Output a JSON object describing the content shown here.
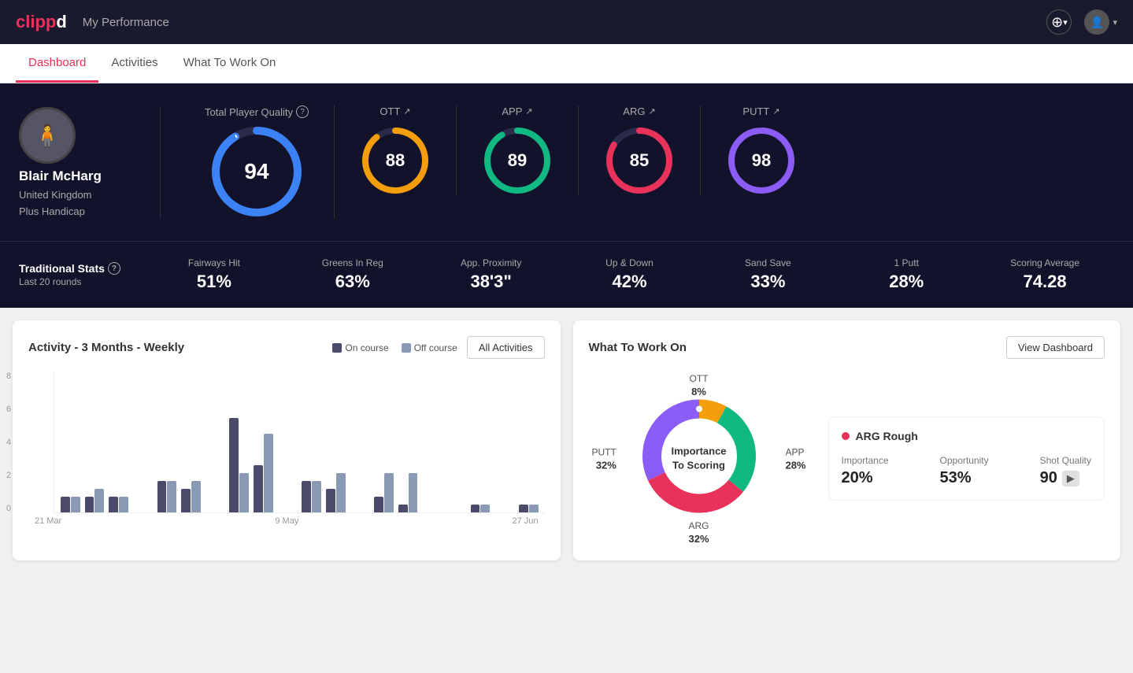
{
  "header": {
    "logo": "clippd",
    "title": "My Performance",
    "add_icon": "+",
    "chevron_down": "▾"
  },
  "tabs": [
    {
      "id": "dashboard",
      "label": "Dashboard",
      "active": true
    },
    {
      "id": "activities",
      "label": "Activities",
      "active": false
    },
    {
      "id": "what-to-work-on",
      "label": "What To Work On",
      "active": false
    }
  ],
  "player": {
    "name": "Blair McHarg",
    "country": "United Kingdom",
    "handicap": "Plus Handicap"
  },
  "scores": {
    "total": {
      "label": "Total Player Quality",
      "value": "94",
      "color": "#3b82f6"
    },
    "ott": {
      "label": "OTT",
      "value": "88",
      "color": "#f59e0b"
    },
    "app": {
      "label": "APP",
      "value": "89",
      "color": "#10b981"
    },
    "arg": {
      "label": "ARG",
      "value": "85",
      "color": "#e8325a"
    },
    "putt": {
      "label": "PUTT",
      "value": "98",
      "color": "#8b5cf6"
    }
  },
  "traditional_stats": {
    "title": "Traditional Stats",
    "subtitle": "Last 20 rounds",
    "stats": [
      {
        "label": "Fairways Hit",
        "value": "51%"
      },
      {
        "label": "Greens In Reg",
        "value": "63%"
      },
      {
        "label": "App. Proximity",
        "value": "38'3\""
      },
      {
        "label": "Up & Down",
        "value": "42%"
      },
      {
        "label": "Sand Save",
        "value": "33%"
      },
      {
        "label": "1 Putt",
        "value": "28%"
      },
      {
        "label": "Scoring Average",
        "value": "74.28"
      }
    ]
  },
  "activity_chart": {
    "title": "Activity - 3 Months - Weekly",
    "legend": {
      "on_course": "On course",
      "off_course": "Off course"
    },
    "all_activities_btn": "All Activities",
    "y_axis": [
      "8",
      "6",
      "4",
      "2",
      "0"
    ],
    "x_axis": [
      "21 Mar",
      "9 May",
      "27 Jun"
    ],
    "bars": [
      {
        "on": 1,
        "off": 1
      },
      {
        "on": 1,
        "off": 1.5
      },
      {
        "on": 1,
        "off": 1
      },
      {
        "on": 0,
        "off": 0
      },
      {
        "on": 2,
        "off": 2
      },
      {
        "on": 1.5,
        "off": 2
      },
      {
        "on": 0,
        "off": 0
      },
      {
        "on": 6,
        "off": 2.5
      },
      {
        "on": 3,
        "off": 5
      },
      {
        "on": 0,
        "off": 0
      },
      {
        "on": 2,
        "off": 2
      },
      {
        "on": 1.5,
        "off": 2.5
      },
      {
        "on": 0,
        "off": 0
      },
      {
        "on": 1,
        "off": 2.5
      },
      {
        "on": 0.5,
        "off": 2.5
      },
      {
        "on": 0,
        "off": 0
      },
      {
        "on": 0,
        "off": 0
      },
      {
        "on": 0.5,
        "off": 0.5
      },
      {
        "on": 0,
        "off": 0
      },
      {
        "on": 0.5,
        "off": 0.5
      }
    ],
    "max_value": 9
  },
  "what_to_work_on": {
    "title": "What To Work On",
    "view_dashboard_btn": "View Dashboard",
    "donut_center": "Importance\nTo Scoring",
    "segments": [
      {
        "label": "OTT",
        "pct": "8%",
        "color": "#f59e0b",
        "position": "top"
      },
      {
        "label": "APP",
        "pct": "28%",
        "color": "#10b981",
        "position": "right"
      },
      {
        "label": "ARG",
        "pct": "32%",
        "color": "#e8325a",
        "position": "bottom"
      },
      {
        "label": "PUTT",
        "pct": "32%",
        "color": "#8b5cf6",
        "position": "left"
      }
    ],
    "detail": {
      "title": "ARG Rough",
      "dot_color": "#e8325a",
      "metrics": [
        {
          "label": "Importance",
          "value": "20%"
        },
        {
          "label": "Opportunity",
          "value": "53%"
        },
        {
          "label": "Shot Quality",
          "value": "90",
          "badge": true
        }
      ]
    }
  }
}
